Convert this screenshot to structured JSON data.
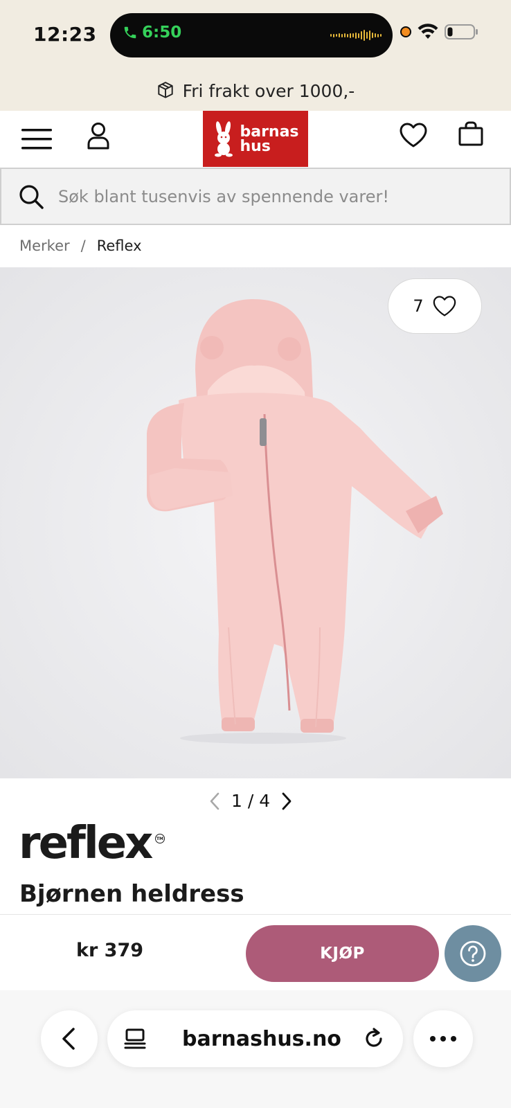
{
  "status_bar": {
    "time": "12:23",
    "call_time": "6:50"
  },
  "promo": {
    "text": "Fri frakt over 1000,-"
  },
  "header": {
    "logo_line1": "barnas",
    "logo_line2": "hus",
    "brand_color": "#c81e1e"
  },
  "search": {
    "placeholder": "Søk blant tusenvis av spennende varer!"
  },
  "breadcrumb": {
    "items": [
      "Merker",
      "Reflex"
    ],
    "separator": "/"
  },
  "product": {
    "favorite_count": "7",
    "pager": "1 / 4",
    "brand": "reflex",
    "brand_mark": "TM",
    "title": "Bjørnen heldress",
    "garment_color": "#f6c9c6"
  },
  "buy_bar": {
    "price": "kr 379",
    "buy_label": "KJØP",
    "buy_color": "#ad5b78",
    "help_color": "#6e8ea1"
  },
  "browser": {
    "url": "barnashus.no"
  }
}
